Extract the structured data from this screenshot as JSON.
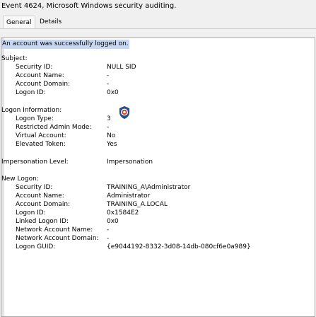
{
  "window": {
    "title": "Event 4624, Microsoft Windows security auditing."
  },
  "tabs": {
    "general": "General",
    "details": "Details"
  },
  "header_line": "An account was successfully logged on.",
  "subject": {
    "heading": "Subject:",
    "security_id_label": "Security ID:",
    "security_id": "NULL SID",
    "account_name_label": "Account Name:",
    "account_name": "-",
    "account_domain_label": "Account Domain:",
    "account_domain": "-",
    "logon_id_label": "Logon ID:",
    "logon_id": "0x0"
  },
  "logon_info": {
    "heading": "Logon Information:",
    "logon_type_label": "Logon Type:",
    "logon_type": "3",
    "restricted_label": "Restricted Admin Mode:",
    "restricted": "-",
    "virtual_label": "Virtual Account:",
    "virtual": "No",
    "elevated_label": "Elevated Token:",
    "elevated": "Yes"
  },
  "impersonation": {
    "label": "Impersonation Level:",
    "value": "Impersonation"
  },
  "new_logon": {
    "heading": "New Logon:",
    "security_id_label": "Security ID:",
    "security_id": "TRAINING_A\\Administrator",
    "account_name_label": "Account Name:",
    "account_name": "Administrator",
    "account_domain_label": "Account Domain:",
    "account_domain": "TRAINING_A.LOCAL",
    "logon_id_label": "Logon ID:",
    "logon_id": "0x1584E2",
    "linked_label": "Linked Logon ID:",
    "linked": "0x0",
    "net_name_label": "Network Account Name:",
    "net_name": "-",
    "net_domain_label": "Network Account Domain:",
    "net_domain": "-",
    "guid_label": "Logon GUID:",
    "guid": "{e9044192-8332-3d08-14db-080cf6e0a989}"
  },
  "icon": "shield-target-icon",
  "colors": {
    "selection": "#c8d6f0",
    "shield_red": "#c0392b",
    "shield_blue": "#2b4a8c"
  }
}
